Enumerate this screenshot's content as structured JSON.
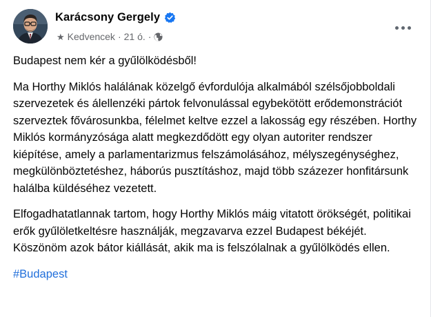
{
  "author": {
    "name": "Karácsony Gergely",
    "verified": true
  },
  "meta": {
    "favorites_label": "Kedvencek",
    "separator": "·",
    "time": "21 ó.",
    "audience_icon": "globe-icon",
    "favorites_icon": "star-icon"
  },
  "post": {
    "paragraphs": [
      "Budapest nem kér a gyűlölködésből!",
      "Ma Horthy Miklós halálának közelgő évfordulója alkalmából szélsőjobboldali szervezetek és álellenzéki pártok felvonulással egybekötött erődemonstrációt szerveztek fővárosunkba, félelmet keltve ezzel a lakosság egy részében. Horthy Miklós kormányzósága alatt megkezdődött egy olyan autoriter rendszer kiépítése, amely a parlamentarizmus felszámolásához, mélyszegénységhez, megkülönböztetéshez, háborús pusztításhoz, majd több százezer honfitársunk halálba küldéséhez vezetett.",
      "Elfogadhatatlannak tartom, hogy Horthy Miklós máig vitatott örökségét, politikai erők gyűlöletkeltésre használják, megzavarva ezzel Budapest békéjét. Köszönöm azok bátor kiállását, akik ma is felszólalnak a gyűlölködés ellen."
    ],
    "hashtag": "#Budapest"
  },
  "colors": {
    "verified_blue": "#1877f2",
    "hashtag_blue": "#216fdb",
    "secondary_text": "#65676b"
  }
}
